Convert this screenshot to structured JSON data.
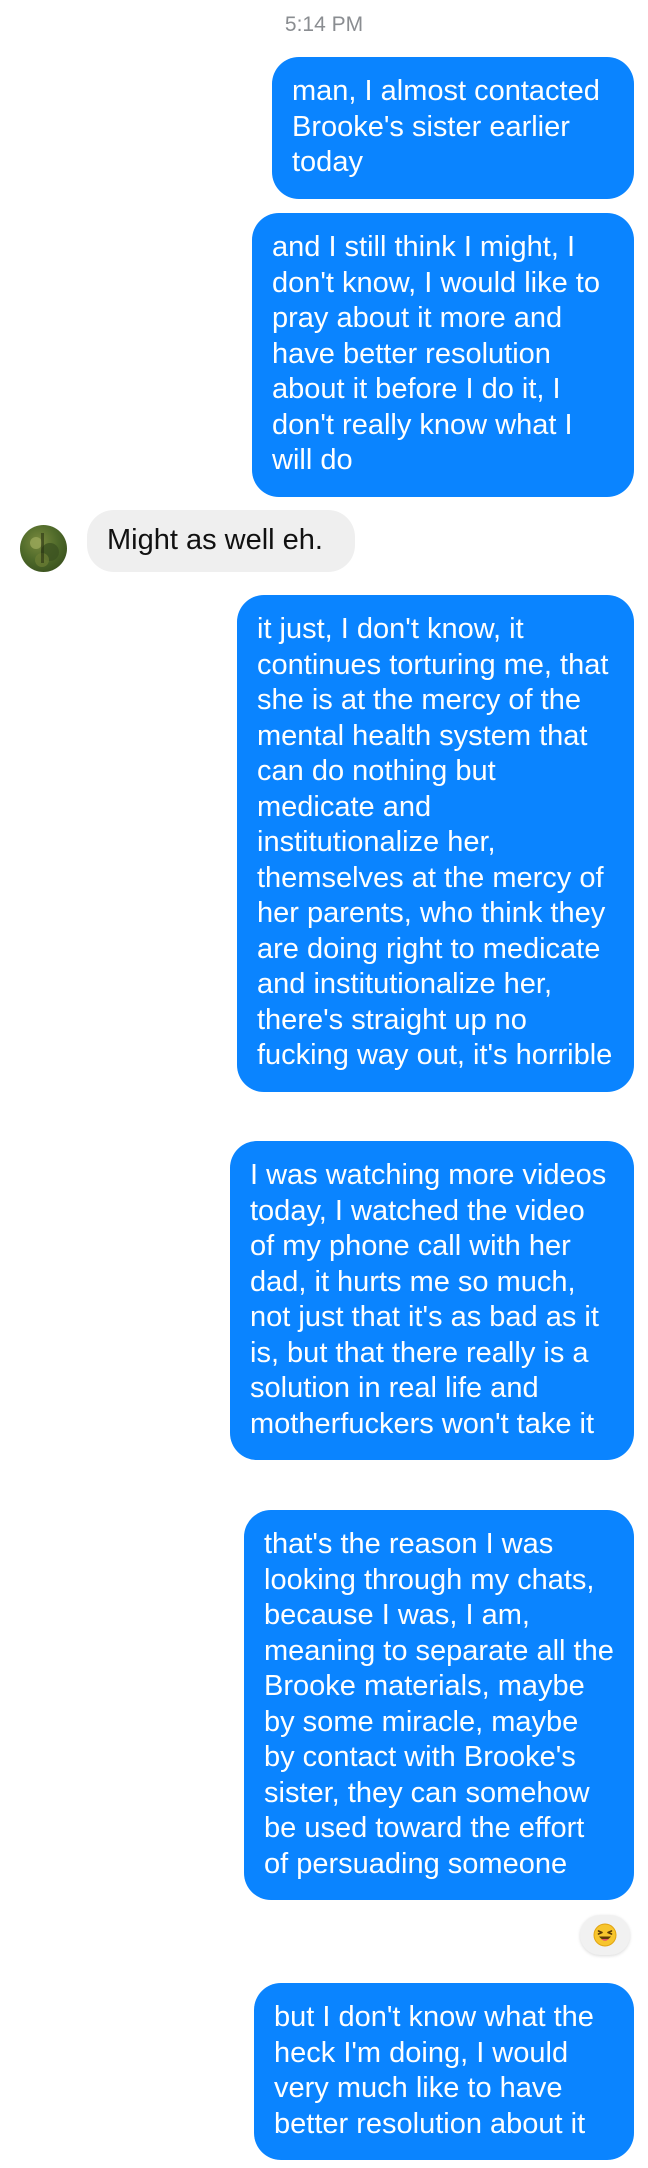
{
  "timestamp": "5:14 PM",
  "messages": [
    {
      "from": "me",
      "text": "man, I almost contacted Brooke's sister earlier today"
    },
    {
      "from": "me",
      "text": "and I still think I might, I don't know, I would like to pray about it more and have better resolution about it before I do it, I don't really know what I will do"
    },
    {
      "from": "them",
      "text": "Might as well eh."
    },
    {
      "from": "me",
      "text": "it just, I don't know, it continues torturing me, that she is at the mercy of the mental health system that can do nothing but medicate and institutionalize her, themselves at the mercy of her parents, who think they are doing right to medicate and institutionalize her, there's straight up no fucking way out, it's horrible"
    },
    {
      "from": "me",
      "text": "I was watching more videos today, I watched the video of my phone call with her dad, it hurts me so much, not just that it's as bad as it is, but that there really is a solution in real life and motherfuckers won't take it"
    },
    {
      "from": "me",
      "text": "that's the reason I was looking through my chats, because I was, I am, meaning to separate all the Brooke materials, maybe by some miracle, maybe by contact with Brooke's sister, they can somehow be used toward the effort of persuading someone",
      "reaction": "laughing-emoji-icon"
    },
    {
      "from": "me",
      "text": "but I don't know what the heck I'm doing, I would very much like to have better resolution about it"
    }
  ],
  "colors": {
    "outgoing_bubble": "#0a84ff",
    "incoming_bubble": "#efefef",
    "timestamp": "#8a8d91"
  }
}
